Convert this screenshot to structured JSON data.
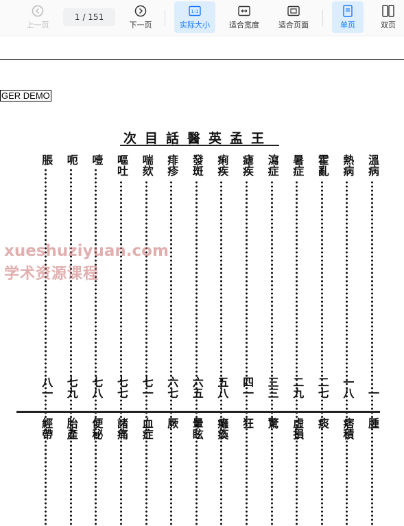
{
  "toolbar": {
    "prev_label": "上一页",
    "next_label": "下一页",
    "current_page": "1",
    "total_pages": "/ 151",
    "actual_size_label": "实际大小",
    "fit_width_label": "适合宽度",
    "fit_page_label": "适合页面",
    "single_page_label": "单页",
    "double_page_label": "双页"
  },
  "document": {
    "demo_label": "GER DEMO",
    "title": "王孟英醫話目次",
    "top_row": [
      {
        "label": "溫病",
        "page": "一"
      },
      {
        "label": "熱病",
        "page": "一八"
      },
      {
        "label": "霍亂",
        "page": "二七"
      },
      {
        "label": "暑症",
        "page": "二九"
      },
      {
        "label": "瀉症",
        "page": "三三"
      },
      {
        "label": "瘧疾",
        "page": "四一"
      },
      {
        "label": "痢疾",
        "page": "五八"
      },
      {
        "label": "發斑",
        "page": "六五"
      },
      {
        "label": "痱疹",
        "page": "六七"
      },
      {
        "label": "喘欬",
        "page": "七一"
      },
      {
        "label": "嘔吐",
        "page": "七七"
      },
      {
        "label": "噎",
        "page": "七八"
      },
      {
        "label": "呃",
        "page": "七九"
      },
      {
        "label": "脹",
        "page": "八一"
      }
    ],
    "bottom_row": [
      {
        "label": "腫"
      },
      {
        "label": "痞積"
      },
      {
        "label": "痰"
      },
      {
        "label": "虛損"
      },
      {
        "label": "驚"
      },
      {
        "label": "狂"
      },
      {
        "label": "癱瘓"
      },
      {
        "label": "暈眩"
      },
      {
        "label": "厥"
      },
      {
        "label": "血症"
      },
      {
        "label": "諸痛"
      },
      {
        "label": "便秘"
      },
      {
        "label": "胎產"
      },
      {
        "label": "經帶"
      }
    ]
  },
  "watermark": {
    "line1": "xueshuziyuan.com",
    "line2": "学术资源课程"
  }
}
